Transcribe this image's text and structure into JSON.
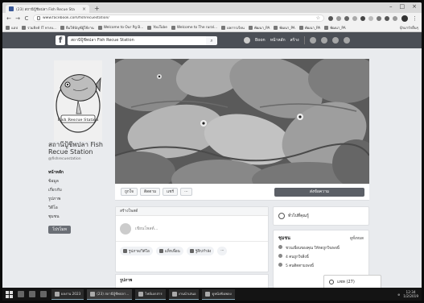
{
  "browser": {
    "tab_title": "(23) สถานีปู้ชีพปลา Fish Recue Sta",
    "tab_close": "×",
    "newtab": "+",
    "window_min": "–",
    "window_max": "□",
    "window_close": "×",
    "back": "←",
    "forward": "→",
    "reload": "C",
    "url": "www.facebook.com/fishrecuestation/",
    "bookmarks": [
      "แอป",
      "รวมลิงค์ IT ทางบ...",
      "ยืมใช้บัญชีผู้ใช้งาน",
      "Welcome to Our Pg B...",
      "YouTube",
      "Welcome to The rural...",
      "ผลการเรียน",
      "พัฒนา_PA",
      "พัฒนา_PA",
      "พัฒนา_PA",
      "พัฒนา_PA"
    ],
    "bookmarks_other": "บุ๊กมาร์กอื่นๆ"
  },
  "fb_header": {
    "logo": "f",
    "search_value": "สถานีปู้ชีพปลา Fish Recue Station",
    "search_icon": "⌕",
    "user_name": "Boon",
    "home": "หน้าหลัก",
    "create": "สร้าง"
  },
  "page": {
    "logo_text": "Fish Rescue Station",
    "name": "สถานีปู้ชีพปลา Fish Recue Station",
    "handle": "@fishrecuestation",
    "nav": [
      "หน้าหลัก",
      "ข้อมูล",
      "เกี่ยวกับ",
      "รูปภาพ",
      "วิดีโอ",
      "ชุมชน"
    ],
    "promote": "โปรโมท",
    "actions": [
      "ถูกใจ",
      "ติดตาม",
      "แชร์",
      "···"
    ],
    "send_message": "ส่งข้อความ"
  },
  "composer": {
    "header": "สร้างโพสต์",
    "placeholder": "เขียนโพสต์...",
    "tools": [
      "รูปภาพ/วิดีโอ",
      "แท็กเพื่อน",
      "รู้สึก/กำลัง",
      "···"
    ]
  },
  "posts_header": "รูปภาพ",
  "sidebar": {
    "card1_label": "ทั่วไปที่คุณรู้",
    "community_title": "ชุมชน",
    "community_link": "ดูทั้งหมด",
    "lines": [
      "ชวนเพื่อนของคุณ ให้กดถูกใจเพจนี้",
      "4 คนถูกใจสิ่งนี้",
      "5 คนติดตามเพจนี้"
    ]
  },
  "chat": {
    "label": "แชท (27)"
  },
  "taskbar": {
    "apps": [
      "ผลงาน 2023",
      "(23) สถานีปู้ชีพปลา...",
      "ไฟล์เอกสาร",
      "งานนำเสนอ",
      "ดูหนังฟังเพลง"
    ],
    "tray": "ค",
    "time": "12:34",
    "date": "1/2/2019"
  },
  "colors": {
    "fb_bar": "#4b4f56",
    "page_bg": "#e9ebee",
    "taskbar": "#141414"
  }
}
